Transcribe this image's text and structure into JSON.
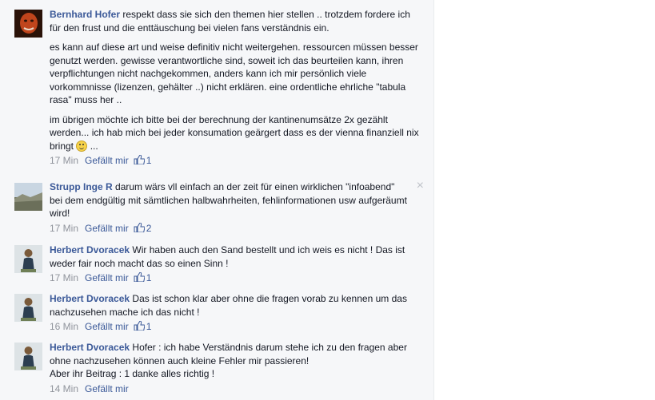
{
  "comments": [
    {
      "author": "Bernhard Hofer",
      "paragraphs": [
        "respekt dass sie sich den themen hier stellen .. trotzdem fordere ich für den frust und die enttäuschung bei vielen fans verständnis ein.",
        "es kann auf diese art und weise definitiv nicht weitergehen. ressourcen müssen besser genutzt werden. gewisse verantwortliche sind, soweit ich das beurteilen kann, ihren verpflichtungen nicht nachgekommen, anders kann ich mir persönlich viele vorkommnisse (lizenzen, gehälter ..) nicht erklären. eine ordentliche ehrliche \"tabula rasa\" muss her ..",
        "im übrigen möchte ich bitte bei der berechnung der kantinenumsätze 2x gezählt werden... ich hab mich bei jeder konsumation geärgert dass es der vienna finanziell nix bringt",
        "..."
      ],
      "time": "17 Min",
      "like_label": "Gefällt mir",
      "likes": "1"
    },
    {
      "author": "Strupp Inge R",
      "paragraphs": [
        "darum wärs vll einfach an der zeit für einen wirklichen \"infoabend\" bei dem endgültig mit sämtlichen halbwahrheiten, fehlinformationen usw aufgeräumt wird!"
      ],
      "time": "17 Min",
      "like_label": "Gefällt mir",
      "likes": "2",
      "close": "×"
    },
    {
      "author": "Herbert Dvoracek",
      "paragraphs": [
        "Wir haben auch den Sand bestellt und ich weis es nicht ! Das ist weder fair noch macht das so einen Sinn !"
      ],
      "time": "17 Min",
      "like_label": "Gefällt mir",
      "likes": "1"
    },
    {
      "author": "Herbert Dvoracek",
      "paragraphs": [
        "Das ist schon klar aber ohne die fragen vorab zu kennen um das nachzusehen mache ich das nicht !"
      ],
      "time": "16 Min",
      "like_label": "Gefällt mir",
      "likes": "1"
    },
    {
      "author": "Herbert Dvoracek",
      "paragraphs": [
        "Hofer : ich habe Verständnis darum stehe ich zu den fragen aber ohne nachzusehen können auch kleine Fehler mir passieren!",
        "Aber ihr Beitrag : 1 danke alles richtig !"
      ],
      "time": "14 Min",
      "like_label": "Gefällt mir"
    }
  ]
}
